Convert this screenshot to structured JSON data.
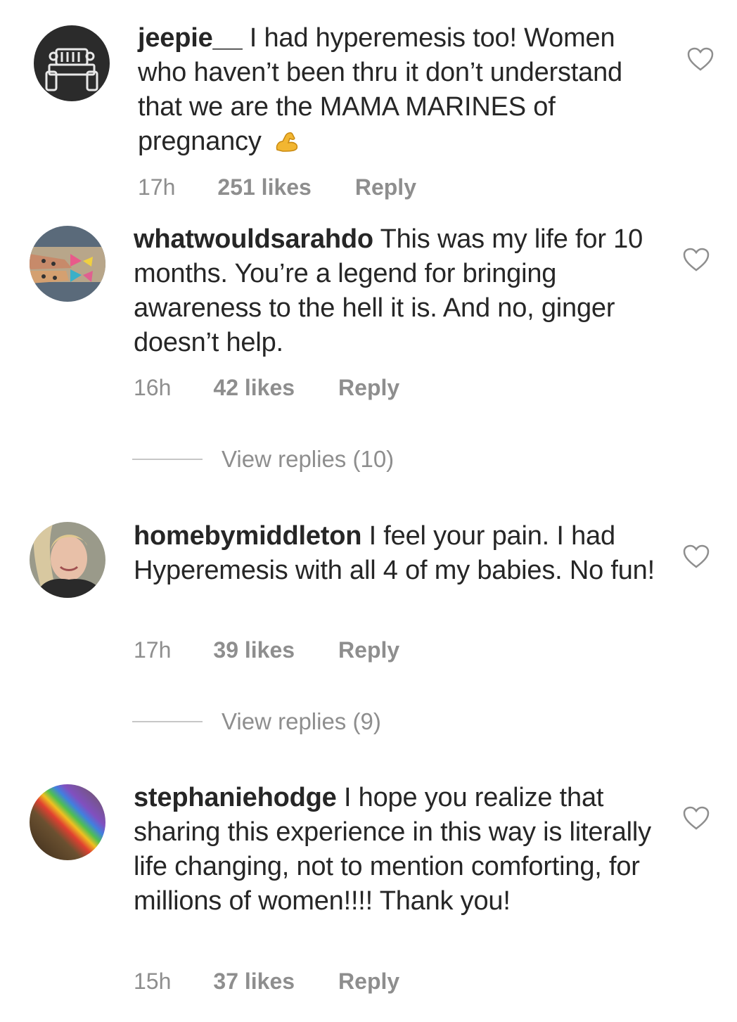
{
  "comments": [
    {
      "username": "jeepie__",
      "text": "I had hyperemesis too! Women who haven’t been thru it don’t understand that we are the MAMA MARINES of pregnancy",
      "emoji": "flexed-biceps",
      "time": "17h",
      "likes": "251 likes",
      "reply": "Reply"
    },
    {
      "username": "whatwouldsarahdo",
      "text": "This was my life for 10 months. You’re a legend for bringing awareness to the hell it is. And no, ginger doesn’t help.",
      "time": "16h",
      "likes": "42 likes",
      "reply": "Reply",
      "view_replies": "View replies (10)"
    },
    {
      "username": "homebymiddleton",
      "text": "I feel your pain. I had Hyperemesis with all 4 of my babies. No fun!",
      "time": "17h",
      "likes": "39 likes",
      "reply": "Reply",
      "view_replies": "View replies (9)"
    },
    {
      "username": "stephaniehodge",
      "text": "I hope you realize that sharing this experience in this way is literally life changing, not to mention comforting, for millions of women!!!! Thank you!",
      "time": "15h",
      "likes": "37 likes",
      "reply": "Reply"
    }
  ],
  "colors": {
    "text": "#262626",
    "secondary": "#8e8e8e",
    "divider": "#c7c7c7"
  }
}
